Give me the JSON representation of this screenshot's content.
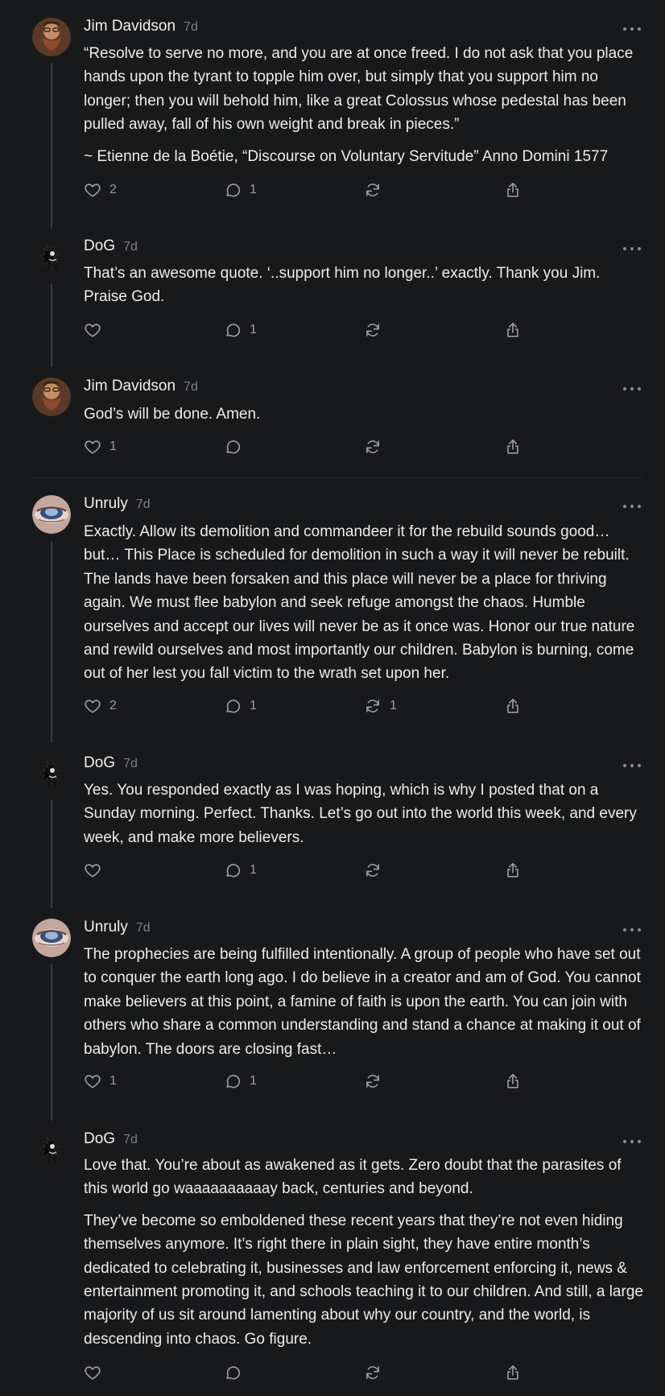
{
  "posts": [
    {
      "author": "Jim Davidson",
      "time": "7d",
      "avatar": "avatar-jim",
      "paragraphs": [
        "“Resolve to serve no more, and you are at once freed. I do not ask that you place hands upon the tyrant to topple him over, but simply that you support him no longer; then you will behold him, like a great Colossus whose pedestal has been pulled away, fall of his own weight and break in pieces.”",
        "~ Etienne de la Boétie, “Discourse on Voluntary Servitude” Anno Domini 1577"
      ],
      "likes": "2",
      "replies": "1",
      "reposts": ""
    },
    {
      "author": "DoG",
      "time": "7d",
      "avatar": "avatar-dog",
      "paragraphs": [
        "That’s an awesome quote. ‘..support him no longer..’ exactly. Thank you Jim. Praise God."
      ],
      "likes": "",
      "replies": "1",
      "reposts": ""
    },
    {
      "author": "Jim Davidson",
      "time": "7d",
      "avatar": "avatar-jim",
      "paragraphs": [
        "God’s will be done. Amen."
      ],
      "likes": "1",
      "replies": "",
      "reposts": ""
    },
    {
      "author": "Unruly",
      "time": "7d",
      "avatar": "avatar-unruly",
      "paragraphs": [
        "Exactly. Allow its demolition and commandeer it for the rebuild sounds good… but… This Place is scheduled for demolition in such a way it will never be rebuilt. The lands have been forsaken and this place will never be a place for thriving again. We must flee babylon and seek refuge amongst the chaos. Humble ourselves and accept our lives will never be as it once was. Honor our true nature and rewild ourselves and most importantly our children. Babylon is burning, come out of her lest you fall victim to the wrath set upon her."
      ],
      "likes": "2",
      "replies": "1",
      "reposts": "1"
    },
    {
      "author": "DoG",
      "time": "7d",
      "avatar": "avatar-dog",
      "paragraphs": [
        "Yes. You responded exactly as I was hoping, which is why I posted that on a Sunday morning. Perfect. Thanks. Let’s go out into the world this week, and every week, and make more believers."
      ],
      "likes": "",
      "replies": "1",
      "reposts": ""
    },
    {
      "author": "Unruly",
      "time": "7d",
      "avatar": "avatar-unruly",
      "paragraphs": [
        "The prophecies are being fulfilled intentionally. A group of people who have set out to conquer the earth long ago. I do believe in a creator and am of God. You cannot make believers at this point, a famine of faith is upon the earth. You can join with others who share a common understanding and stand a chance at making it out of babylon. The doors are closing fast…"
      ],
      "likes": "1",
      "replies": "1",
      "reposts": ""
    },
    {
      "author": "DoG",
      "time": "7d",
      "avatar": "avatar-dog",
      "paragraphs": [
        "Love that. You’re about as awakened as it gets. Zero doubt that the parasites of this world go waaaaaaaaaay back, centuries and beyond.",
        "They’ve become so emboldened these recent years that they’re not even hiding themselves anymore. It’s right there in plain sight, they have entire month’s dedicated to celebrating it, businesses and law enforcement enforcing it, news & entertainment promoting it, and schools teaching it to our children. And still, a large majority of us sit around lamenting about why our country, and the world, is descending into chaos. Go figure."
      ],
      "likes": "",
      "replies": "",
      "reposts": ""
    }
  ],
  "icons": {
    "like": "heart-icon",
    "reply": "comment-bubble-icon",
    "repost": "repost-arrows-icon",
    "share": "share-icon",
    "more": "more-dots-icon"
  },
  "colors": {
    "background": "#18191b",
    "text": "#ececec",
    "muted": "#7d7f84",
    "thread_line": "#3a3b3e"
  }
}
